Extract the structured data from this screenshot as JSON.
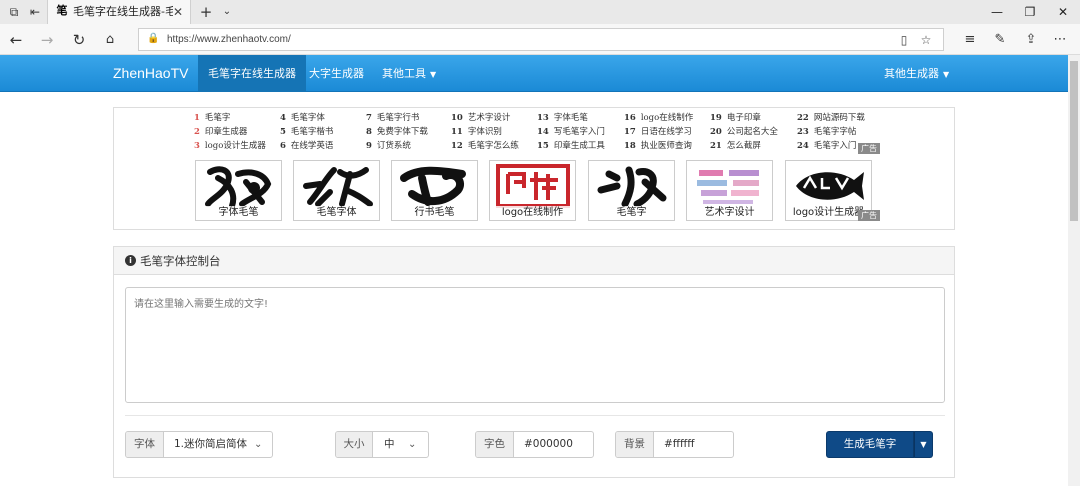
{
  "browser": {
    "tab_title": "毛笔字在线生成器-毛笔",
    "tab_favicon": "笔",
    "url": "https://www.zhenhaotv.com/",
    "icons": [
      "tab-manager-icon",
      "set-aside-tabs-icon",
      "close-icon",
      "new-tab-icon",
      "chevron-down-icon",
      "minimize-icon",
      "maximize-icon",
      "window-close-icon",
      "back-icon",
      "forward-icon",
      "refresh-icon",
      "home-icon",
      "lock-icon",
      "reading-view-icon",
      "favorite-star-icon",
      "favorites-icon",
      "pen-icon",
      "share-icon",
      "more-icon"
    ]
  },
  "navbar": {
    "brand": "ZhenHaoTV",
    "items": [
      {
        "label": "毛笔字在线生成器",
        "active": true
      },
      {
        "label": "大字生成器",
        "active": false
      },
      {
        "label": "其他工具",
        "active": false,
        "dropdown": true
      }
    ],
    "right_item": "其他生成器",
    "color": "#2a97df"
  },
  "ad_links": [
    {
      "num": "1",
      "text": "毛笔字"
    },
    {
      "num": "2",
      "text": "印章生成器"
    },
    {
      "num": "3",
      "text": "logo设计生成器"
    },
    {
      "num": "4",
      "text": "毛笔字体"
    },
    {
      "num": "5",
      "text": "毛笔字楷书"
    },
    {
      "num": "6",
      "text": "在线学英语"
    },
    {
      "num": "7",
      "text": "毛笔字行书"
    },
    {
      "num": "8",
      "text": "免费字体下载"
    },
    {
      "num": "9",
      "text": "订货系统"
    },
    {
      "num": "10",
      "text": "艺术字设计"
    },
    {
      "num": "11",
      "text": "字体识别"
    },
    {
      "num": "12",
      "text": "毛笔字怎么练"
    },
    {
      "num": "13",
      "text": "字体毛笔"
    },
    {
      "num": "14",
      "text": "写毛笔字入门"
    },
    {
      "num": "15",
      "text": "印章生成工具"
    },
    {
      "num": "16",
      "text": "logo在线制作"
    },
    {
      "num": "17",
      "text": "日语在线学习"
    },
    {
      "num": "18",
      "text": "执业医师查询"
    },
    {
      "num": "19",
      "text": "电子印章"
    },
    {
      "num": "20",
      "text": "公司起名大全"
    },
    {
      "num": "21",
      "text": "怎么截屏"
    },
    {
      "num": "22",
      "text": "网站源码下载"
    },
    {
      "num": "23",
      "text": "毛笔字字帖"
    },
    {
      "num": "24",
      "text": "毛笔字入门"
    }
  ],
  "ad_tag": "广告",
  "thumbnails": [
    {
      "caption": "字体毛笔"
    },
    {
      "caption": "毛笔字体"
    },
    {
      "caption": "行书毛笔"
    },
    {
      "caption": "logo在线制作"
    },
    {
      "caption": "毛笔字"
    },
    {
      "caption": "艺术字设计"
    },
    {
      "caption": "logo设计生成器"
    }
  ],
  "panel": {
    "title": "毛笔字体控制台",
    "textarea_placeholder": "请在这里输入需要生成的文字!",
    "font": {
      "label": "字体",
      "value": "1.迷你简启简体"
    },
    "size": {
      "label": "大小",
      "value": "中"
    },
    "color": {
      "label": "字色",
      "value": "#000000"
    },
    "background": {
      "label": "背景",
      "value": "#ffffff"
    },
    "generate_button": "生成毛笔字",
    "button_color": "#0f4a87"
  }
}
